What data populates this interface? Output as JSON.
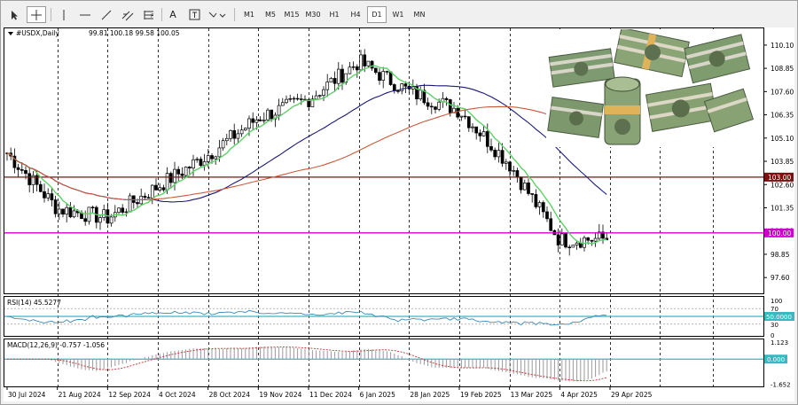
{
  "toolbar": {
    "timeframes": [
      "M1",
      "M5",
      "M15",
      "M30",
      "H1",
      "H4",
      "D1",
      "W1",
      "MN"
    ],
    "active_timeframe": "D1"
  },
  "header": {
    "symbol": "#USDX,Daily",
    "ohlc": "99.81 100.18 99.58 100.05"
  },
  "rsi": {
    "label": "RSI(14) 45.5277"
  },
  "macd": {
    "label": "MACD(12,26,9) -0.757 -1.056"
  },
  "colors": {
    "candle": "#000000",
    "ma_fast": "#5fd068",
    "ma_mid": "#1a1a7a",
    "ma_slow": "#c85a3c",
    "level_100": "#cc00cc",
    "level_103": "#7a1010",
    "indicator_line": "#3a8ab8",
    "signal_line": "#c03030",
    "zero_line": "#3ab8c0"
  },
  "chart_data": [
    {
      "type": "candlestick",
      "title": "#USDX,Daily",
      "x_labels": [
        "30 Jul 2024",
        "21 Aug 2024",
        "12 Sep 2024",
        "4 Oct 2024",
        "28 Oct 2024",
        "19 Nov 2024",
        "11 Dec 2024",
        "6 Jan 2025",
        "28 Jan 2025",
        "19 Feb 2025",
        "13 Mar 2025",
        "4 Apr 2025",
        "29 Apr 2025"
      ],
      "y_ticks": [
        110.1,
        108.85,
        107.6,
        106.35,
        105.1,
        103.85,
        102.6,
        101.35,
        100.1,
        98.85,
        97.6
      ],
      "ylim": [
        96.75,
        111.0
      ],
      "price_tags": [
        "103.00",
        "100.00"
      ],
      "horizontal_levels": [
        {
          "value": 103.0,
          "color": "#7a1010"
        },
        {
          "value": 100.0,
          "color": "#cc00cc"
        }
      ],
      "close_path": [
        {
          "x": "30 Jul 2024",
          "y": 104.3
        },
        {
          "x": "21 Aug 2024",
          "y": 101.3
        },
        {
          "x": "12 Sep 2024",
          "y": 100.8
        },
        {
          "x": "4 Oct 2024",
          "y": 102.5
        },
        {
          "x": "28 Oct 2024",
          "y": 104.2
        },
        {
          "x": "19 Nov 2024",
          "y": 106.2
        },
        {
          "x": "11 Dec 2024",
          "y": 107.2
        },
        {
          "x": "6 Jan 2025",
          "y": 109.2
        },
        {
          "x": "28 Jan 2025",
          "y": 107.6
        },
        {
          "x": "19 Feb 2025",
          "y": 106.6
        },
        {
          "x": "13 Mar 2025",
          "y": 103.7
        },
        {
          "x": "4 Apr 2025",
          "y": 99.6
        },
        {
          "x": "29 Apr 2025",
          "y": 99.7
        }
      ]
    },
    {
      "type": "line",
      "title": "RSI(14) 45.5277",
      "y_ticks": [
        100,
        70,
        30,
        0
      ],
      "ylim": [
        0,
        100
      ],
      "price_tags": [
        "50.0000"
      ]
    },
    {
      "type": "bar",
      "title": "MACD(12,26,9) -0.757 -1.056",
      "y_ticks": [
        1.123,
        -1.652
      ],
      "ylim": [
        -1.8,
        1.3
      ],
      "price_tags": [
        "0.000"
      ]
    }
  ]
}
